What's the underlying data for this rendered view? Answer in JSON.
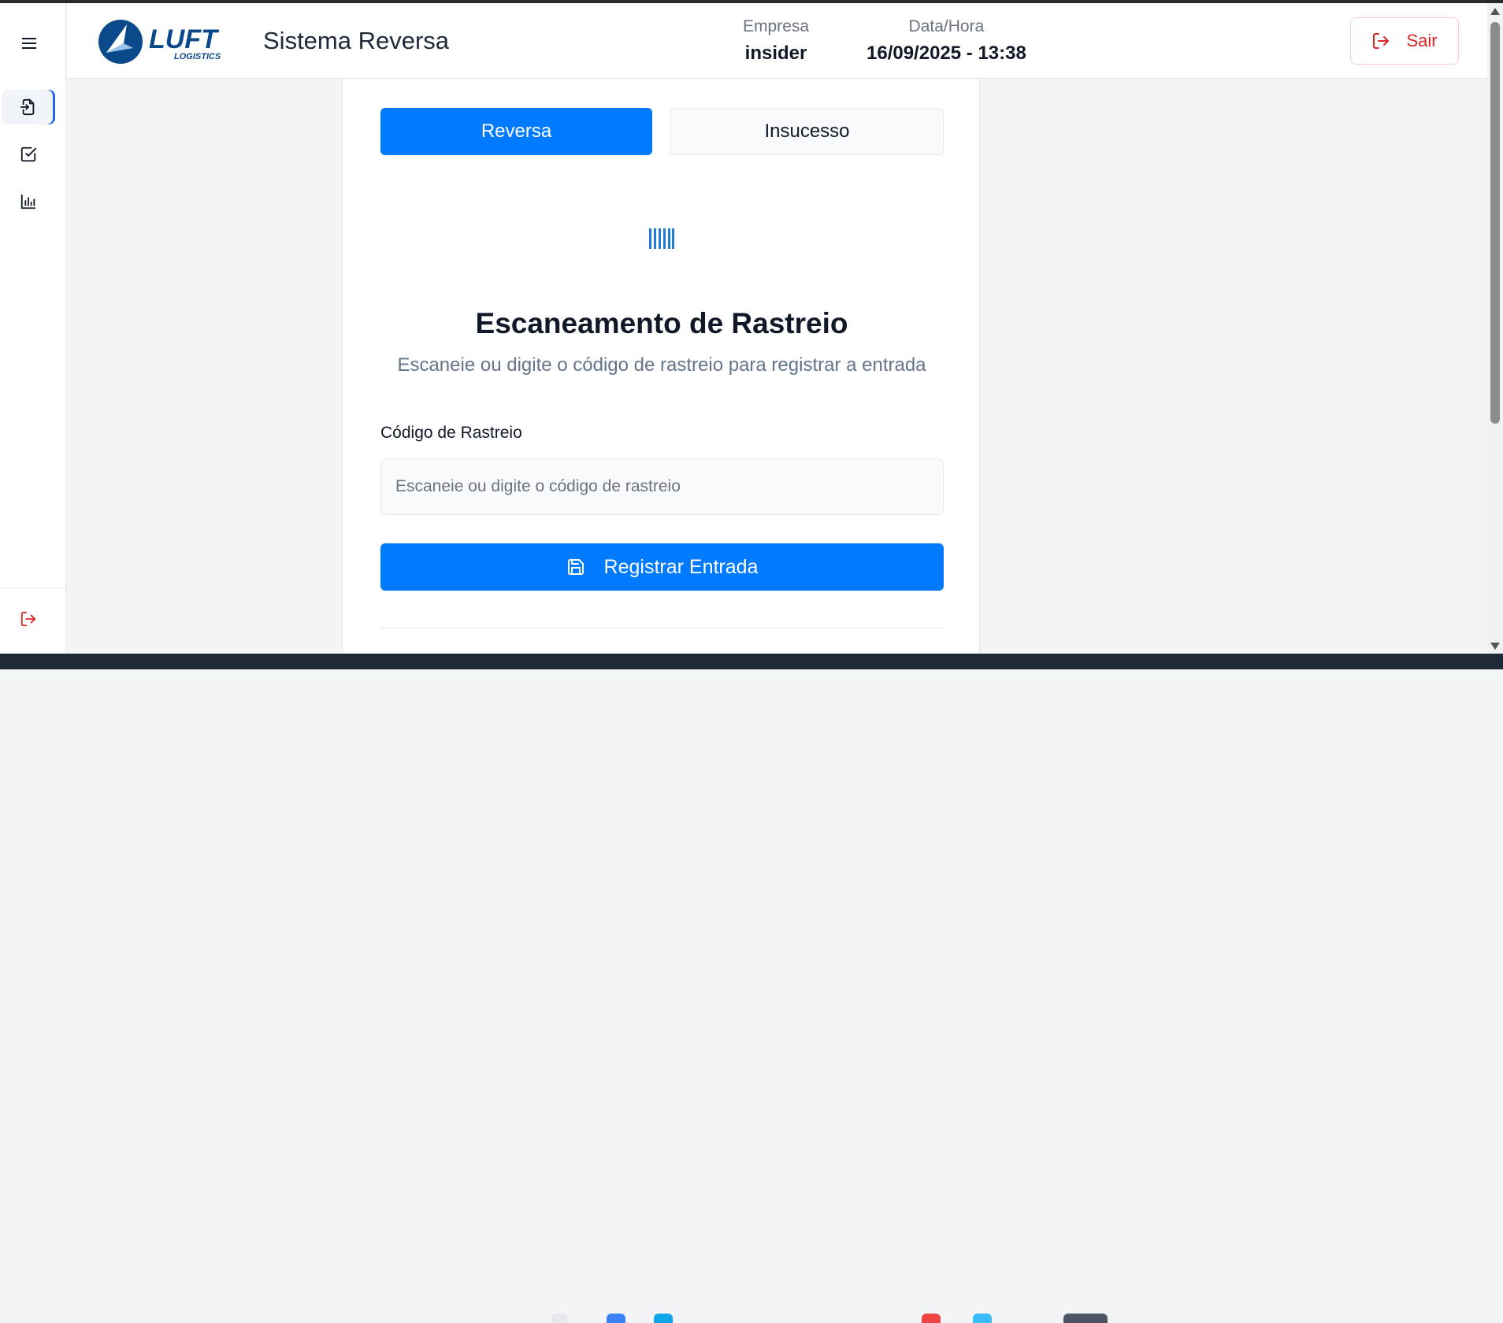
{
  "header": {
    "title": "Sistema Reversa",
    "logo_text": "LUFT",
    "logo_subtext": "LOGISTICS",
    "company_label": "Empresa",
    "company_value": "insider",
    "datetime_label": "Data/Hora",
    "datetime_value": "16/09/2025 - 13:38",
    "logout_label": "Sair"
  },
  "sidebar": {
    "items": [
      {
        "name": "entry",
        "icon": "file-import-icon",
        "active": true
      },
      {
        "name": "checklist",
        "icon": "check-square-icon",
        "active": false
      },
      {
        "name": "reports",
        "icon": "bar-chart-icon",
        "active": false
      }
    ],
    "logout_icon": "logout-icon"
  },
  "tabs": [
    {
      "label": "Reversa",
      "active": true
    },
    {
      "label": "Insucesso",
      "active": false
    }
  ],
  "scanner": {
    "icon": "barcode-icon",
    "title": "Escaneamento de Rastreio",
    "subtitle": "Escaneie ou digite o código de rastreio para registrar a entrada",
    "field_label": "Código de Rastreio",
    "input_value": "",
    "input_placeholder": "Escaneie ou digite o código de rastreio",
    "submit_label": "Registrar Entrada"
  },
  "colors": {
    "primary": "#007bff",
    "danger": "#dc2626",
    "logo_blue": "#0b4a8a"
  }
}
